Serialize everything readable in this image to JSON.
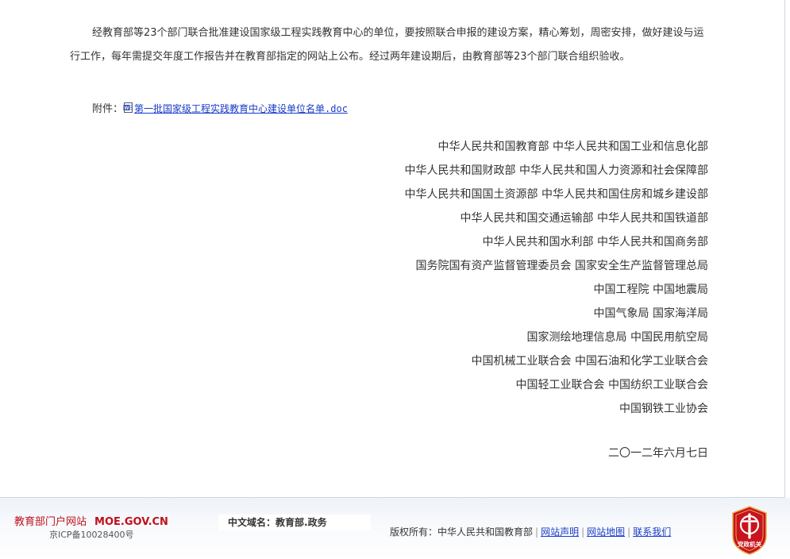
{
  "article": {
    "paragraph": "经教育部等23个部门联合批准建设国家级工程实践教育中心的单位，要按照联合申报的建设方案，精心筹划，周密安排，做好建设与运行工作，每年需提交年度工作报告并在教育部指定的网站上公布。经过两年建设期后，由教育部等23个部门联合组织验收。",
    "attachment_label": "附件：",
    "attachment_icon": "word-doc-icon",
    "attachment_link": "第一批国家级工程实践教育中心建设单位名单.doc",
    "signers": [
      "中华人民共和国教育部  中华人民共和国工业和信息化部",
      "中华人民共和国财政部  中华人民共和国人力资源和社会保障部",
      "中华人民共和国国土资源部  中华人民共和国住房和城乡建设部",
      "中华人民共和国交通运输部  中华人民共和国铁道部",
      "中华人民共和国水利部  中华人民共和国商务部",
      "国务院国有资产监督管理委员会  国家安全生产监督管理总局",
      "中国工程院  中国地震局",
      "中国气象局  国家海洋局",
      "国家测绘地理信息局  中国民用航空局",
      "中国机械工业联合会  中国石油和化学工业联合会",
      "中国轻工业联合会  中国纺织工业联合会",
      "中国钢铁工业协会"
    ],
    "date": "二〇一二年六月七日"
  },
  "footer": {
    "portal_name": "教育部门户网站",
    "portal_domain": "MOE.GOV.CN",
    "icp": "京ICP备10028400号",
    "cn_domain_label": "中文域名：",
    "cn_domain_value": "教育部.政务",
    "copyright_label": "版权所有：中华人民共和国教育部",
    "links": [
      "网站声明",
      "网站地图",
      "联系我们"
    ],
    "emblem_text": "党政机关",
    "emblem_icon": "party-government-emblem-icon"
  },
  "colors": {
    "link": "#1a3cc8",
    "portal_red": "#c0101b",
    "emblem_red": "#c8141e"
  }
}
